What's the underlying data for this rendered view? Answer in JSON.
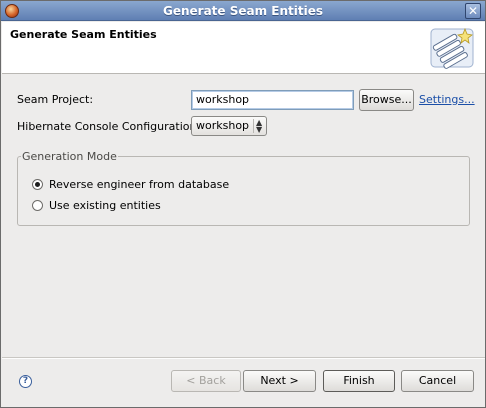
{
  "window": {
    "title": "Generate Seam Entities",
    "close_glyph": "✕"
  },
  "banner": {
    "title": "Generate Seam Entities",
    "icon": "wizard-banner-icon"
  },
  "form": {
    "seam_project_label": "Seam Project:",
    "seam_project_value": "workshop",
    "browse_label": "Browse...",
    "settings_label": "Settings...",
    "console_config_label": "Hibernate Console Configuration:",
    "console_config_value": "workshop"
  },
  "generation_mode": {
    "legend": "Generation Mode",
    "options": [
      {
        "label": "Reverse engineer from database",
        "checked": true
      },
      {
        "label": "Use existing entities",
        "checked": false
      }
    ]
  },
  "footer": {
    "help_glyph": "?",
    "back_label": "< Back",
    "next_label": "Next >",
    "finish_label": "Finish",
    "cancel_label": "Cancel"
  }
}
